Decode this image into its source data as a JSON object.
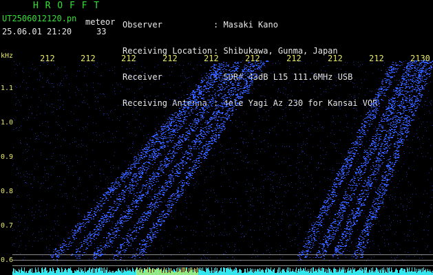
{
  "header": {
    "title": "H R O F F T",
    "filename": "UT2506012120.pn",
    "mode": "meteor",
    "datetime": "25.06.01 21:20",
    "count": "33"
  },
  "info": [
    {
      "label": "Observer",
      "value": ": Masaki Kano"
    },
    {
      "label": "Receiving Location",
      "value": ": Shibukawa, Gunma, Japan"
    },
    {
      "label": "Receiver",
      "value": ": SDR# 43dB L15 111.6MHz USB"
    },
    {
      "label": "Receiving Antenna",
      "value": ": 4ele Yagi Az 230 for Kansai VOR"
    }
  ],
  "axis": {
    "unit": "kHz",
    "y_ticks": [
      "1.1",
      "1.0",
      "0.9",
      "0.8",
      "0.7",
      "0.6"
    ],
    "x_ticks": [
      "212",
      "212",
      "212",
      "212",
      "212",
      "212",
      "212",
      "212",
      "212",
      "2130"
    ]
  },
  "colors": {
    "background": "#000000",
    "header_green": "#35e035",
    "tick_yellow": "#e8e86a",
    "signal_blue": "#2f5cff",
    "floor_cyan": "#34e6ee"
  }
}
